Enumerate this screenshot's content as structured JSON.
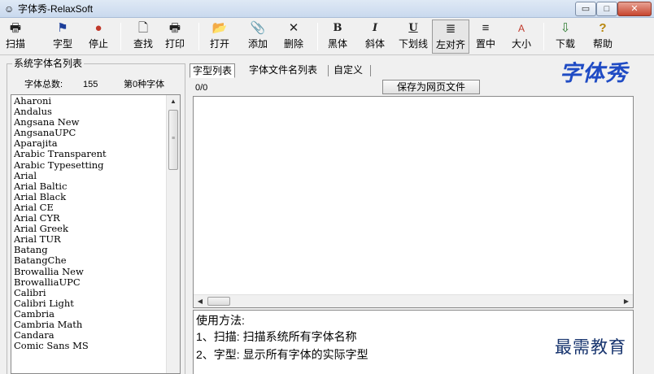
{
  "window": {
    "title": "字体秀-RelaxSoft",
    "app_icon": "☺",
    "min_icon": "▭",
    "max_icon": "□",
    "close_icon": "✕"
  },
  "toolbar": {
    "items": [
      {
        "label": "扫描",
        "icon": "printer-icon",
        "glyph": "🖶"
      },
      {
        "label": "字型",
        "icon": "flag-icon",
        "glyph": "⚑"
      },
      {
        "label": "停止",
        "icon": "stop-icon",
        "glyph": "●"
      },
      {
        "label": "查找",
        "icon": "find-document-icon",
        "glyph": "🗋"
      },
      {
        "label": "打印",
        "icon": "print-icon",
        "glyph": "🖶"
      },
      {
        "label": "打开",
        "icon": "open-folder-icon",
        "glyph": "📂"
      },
      {
        "label": "添加",
        "icon": "paperclip-icon",
        "glyph": "📎"
      },
      {
        "label": "删除",
        "icon": "delete-x-icon",
        "glyph": "✕"
      },
      {
        "label": "黑体",
        "icon": "bold-icon",
        "glyph": "B"
      },
      {
        "label": "斜体",
        "icon": "italic-icon",
        "glyph": "I"
      },
      {
        "label": "下划线",
        "icon": "underline-icon",
        "glyph": "U"
      },
      {
        "label": "左对齐",
        "icon": "align-left-icon",
        "glyph": "≣"
      },
      {
        "label": "置中",
        "icon": "align-center-icon",
        "glyph": "≡"
      },
      {
        "label": "大小",
        "icon": "font-size-icon",
        "glyph": "A"
      },
      {
        "label": "下载",
        "icon": "download-icon",
        "glyph": "⇩"
      },
      {
        "label": "帮助",
        "icon": "help-icon",
        "glyph": "?"
      }
    ]
  },
  "left_panel": {
    "group_title": "系统字体名列表",
    "count_label": "字体总数:",
    "count_value": "155",
    "current_font": "第0种字体",
    "scroll_up": "▲",
    "fonts": [
      "Aharoni",
      "Andalus",
      "Angsana New",
      "AngsanaUPC",
      "Aparajita",
      "Arabic Transparent",
      "Arabic Typesetting",
      "Arial",
      "Arial Baltic",
      "Arial Black",
      "Arial CE",
      "Arial CYR",
      "Arial Greek",
      "Arial TUR",
      "Batang",
      "BatangChe",
      "Browallia New",
      "BrowalliaUPC",
      "Calibri",
      "Calibri Light",
      "Cambria",
      "Cambria Math",
      "Candara",
      "Comic Sans MS"
    ]
  },
  "tabs": [
    {
      "label": "字型列表"
    },
    {
      "label": "字体文件名列表"
    },
    {
      "label": "自定义"
    }
  ],
  "preview": {
    "position": "0/0",
    "save_button": "保存为网页文件",
    "scroll_left": "◀",
    "scroll_right": "▶"
  },
  "usage": {
    "lines": [
      "使用方法:",
      "1、扫描: 扫描系统所有字体名称",
      "2、字型: 显示所有字体的实际字型"
    ]
  },
  "logo_text": "字体秀",
  "watermark": "最需教育",
  "colors": {
    "logo": "#1f4bc4",
    "watermark": "#17346e",
    "close_button": "#c7452f",
    "stop_icon": "#c0392b"
  }
}
